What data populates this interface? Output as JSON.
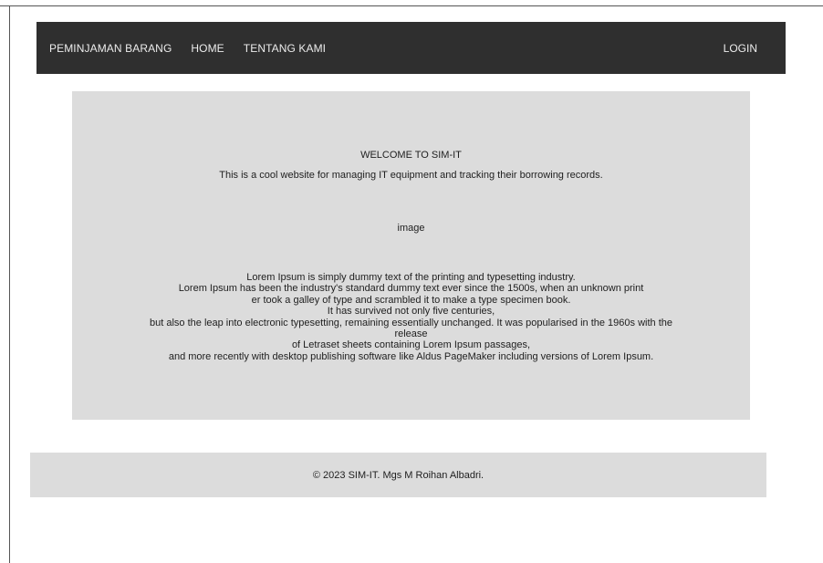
{
  "navbar": {
    "brand": "PEMINJAMAN BARANG",
    "items": [
      "HOME",
      "TENTANG KAMI"
    ],
    "login": "LOGIN"
  },
  "hero": {
    "title": "WELCOME TO SIM-IT",
    "subtitle": "This is a cool website for managing IT equipment and tracking their borrowing records.",
    "image_placeholder": "image",
    "lorem_lines": [
      "Lorem Ipsum is simply dummy text of the printing and typesetting industry.",
      "Lorem Ipsum has been the industry's standard dummy text ever since the 1500s, when an unknown print",
      "er took a galley of type and scrambled it to make a type specimen book.",
      "It has survived not only five centuries,",
      "but also the leap into electronic typesetting, remaining essentially unchanged. It was popularised in the 1960s with the",
      "release",
      "of Letraset sheets containing Lorem Ipsum passages,",
      "and more recently with desktop publishing software like Aldus PageMaker including versions of Lorem Ipsum."
    ]
  },
  "footer": {
    "text": "© 2023 SIM-IT. Mgs M Roihan Albadri."
  }
}
